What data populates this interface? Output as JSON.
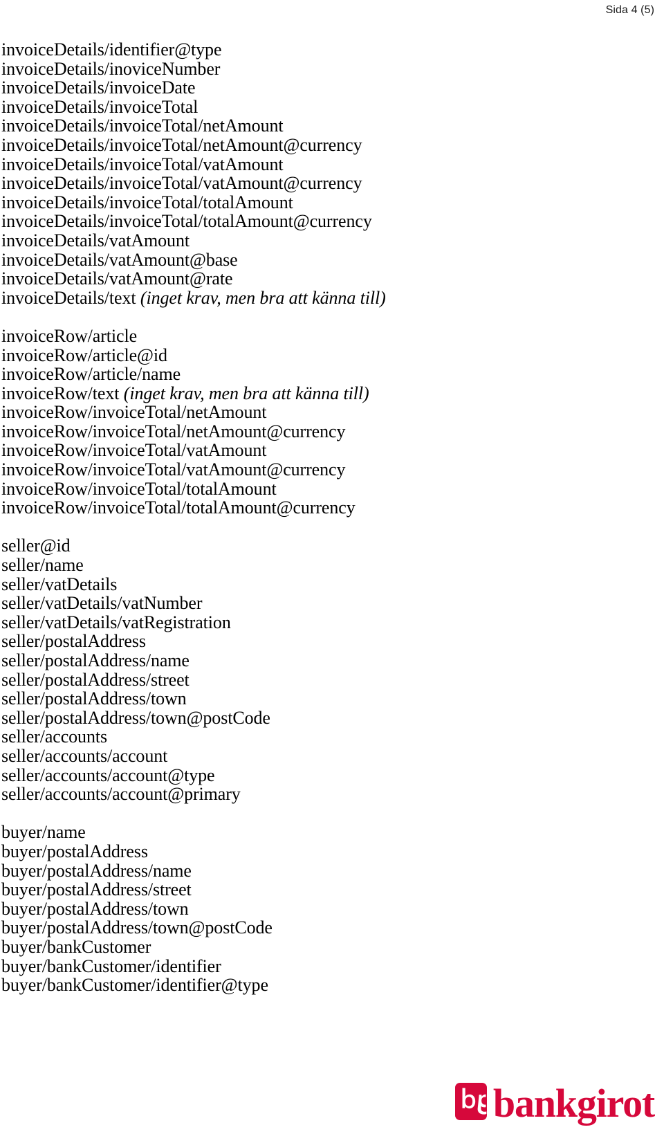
{
  "header": {
    "page_label": "Sida 4 (5)"
  },
  "document": {
    "blocks": [
      {
        "name": "invoice-details",
        "lines": [
          {
            "path": "invoiceDetails/identifier@type"
          },
          {
            "path": "invoiceDetails/inoviceNumber"
          },
          {
            "path": "invoiceDetails/invoiceDate"
          },
          {
            "path": "invoiceDetails/invoiceTotal"
          },
          {
            "path": "invoiceDetails/invoiceTotal/netAmount"
          },
          {
            "path": "invoiceDetails/invoiceTotal/netAmount@currency"
          },
          {
            "path": "invoiceDetails/invoiceTotal/vatAmount"
          },
          {
            "path": "invoiceDetails/invoiceTotal/vatAmount@currency"
          },
          {
            "path": "invoiceDetails/invoiceTotal/totalAmount"
          },
          {
            "path": "invoiceDetails/invoiceTotal/totalAmount@currency"
          },
          {
            "path": "invoiceDetails/vatAmount"
          },
          {
            "path": "invoiceDetails/vatAmount@base"
          },
          {
            "path": "invoiceDetails/vatAmount@rate"
          },
          {
            "path": "invoiceDetails/text ",
            "note": "(inget krav, men bra att känna till)"
          }
        ]
      },
      {
        "name": "invoice-row",
        "lines": [
          {
            "path": "invoiceRow/article"
          },
          {
            "path": "invoiceRow/article@id"
          },
          {
            "path": "invoiceRow/article/name"
          },
          {
            "path": "invoiceRow/text ",
            "note": "(inget krav, men bra att känna till)"
          },
          {
            "path": "invoiceRow/invoiceTotal/netAmount"
          },
          {
            "path": "invoiceRow/invoiceTotal/netAmount@currency"
          },
          {
            "path": "invoiceRow/invoiceTotal/vatAmount"
          },
          {
            "path": "invoiceRow/invoiceTotal/vatAmount@currency"
          },
          {
            "path": "invoiceRow/invoiceTotal/totalAmount"
          },
          {
            "path": "invoiceRow/invoiceTotal/totalAmount@currency"
          }
        ]
      },
      {
        "name": "seller",
        "lines": [
          {
            "path": "seller@id"
          },
          {
            "path": "seller/name"
          },
          {
            "path": "seller/vatDetails"
          },
          {
            "path": "seller/vatDetails/vatNumber"
          },
          {
            "path": "seller/vatDetails/vatRegistration"
          },
          {
            "path": "seller/postalAddress"
          },
          {
            "path": "seller/postalAddress/name"
          },
          {
            "path": "seller/postalAddress/street"
          },
          {
            "path": "seller/postalAddress/town"
          },
          {
            "path": "seller/postalAddress/town@postCode"
          },
          {
            "path": "seller/accounts"
          },
          {
            "path": "seller/accounts/account"
          },
          {
            "path": "seller/accounts/account@type"
          },
          {
            "path": "seller/accounts/account@primary"
          }
        ]
      },
      {
        "name": "buyer",
        "lines": [
          {
            "path": "buyer/name"
          },
          {
            "path": "buyer/postalAddress"
          },
          {
            "path": "buyer/postalAddress/name"
          },
          {
            "path": "buyer/postalAddress/street"
          },
          {
            "path": "buyer/postalAddress/town"
          },
          {
            "path": "buyer/postalAddress/town@postCode"
          },
          {
            "path": "buyer/bankCustomer"
          },
          {
            "path": "buyer/bankCustomer/identifier"
          },
          {
            "path": "buyer/bankCustomer/identifier@type"
          }
        ]
      }
    ]
  },
  "footer": {
    "logo": {
      "mark_label": "bg",
      "wordmark": "bankgirot",
      "color": "#D6083B"
    }
  }
}
